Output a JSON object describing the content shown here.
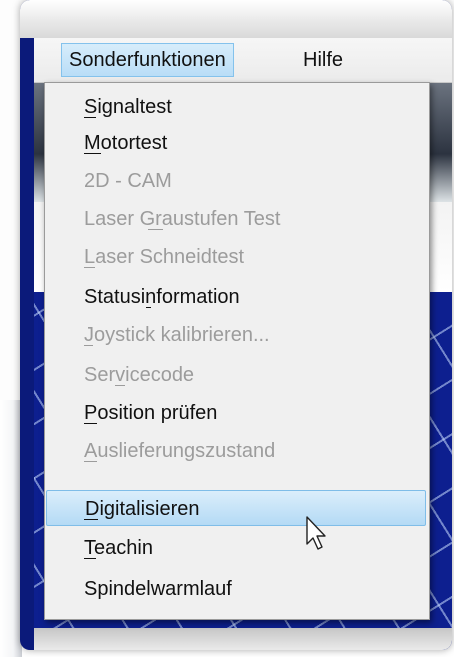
{
  "menubar": {
    "items": [
      {
        "label": "Sonderfunktionen",
        "active": true
      },
      {
        "label": "Hilfe",
        "active": false
      }
    ]
  },
  "dropdown": {
    "items": [
      {
        "label": "Signaltest",
        "enabled": true,
        "mnemonic": "S",
        "highlighted": false
      },
      {
        "label": "Motortest",
        "enabled": true,
        "mnemonic": "M",
        "highlighted": false
      },
      {
        "label": "2D - CAM",
        "enabled": false,
        "mnemonic": "",
        "highlighted": false
      },
      {
        "label": "Laser Graustufen Test",
        "enabled": false,
        "mnemonic": "G",
        "highlighted": false
      },
      {
        "label": "Laser Schneidtest",
        "enabled": false,
        "mnemonic": "L",
        "highlighted": false
      },
      {
        "label": "Statusinformation",
        "enabled": true,
        "mnemonic": "i",
        "highlighted": false
      },
      {
        "label": "Joystick kalibrieren...",
        "enabled": false,
        "mnemonic": "J",
        "highlighted": false
      },
      {
        "label": "Servicecode",
        "enabled": false,
        "mnemonic": "v",
        "highlighted": false
      },
      {
        "label": "Position prüfen",
        "enabled": true,
        "mnemonic": "P",
        "highlighted": false
      },
      {
        "label": "Auslieferungszustand",
        "enabled": false,
        "mnemonic": "A",
        "highlighted": false
      },
      {
        "label": "Digitalisieren",
        "enabled": true,
        "mnemonic": "D",
        "highlighted": true
      },
      {
        "label": "Teachin",
        "enabled": true,
        "mnemonic": "T",
        "highlighted": false
      },
      {
        "label": "Spindelwarmlauf",
        "enabled": true,
        "mnemonic": "",
        "highlighted": false
      }
    ]
  },
  "colors": {
    "highlight": "#b4daf5",
    "disabled_text": "#9c9c9c",
    "canvas": "#0d1f8f"
  },
  "icons": {
    "cursor": "mouse-pointer-icon"
  }
}
